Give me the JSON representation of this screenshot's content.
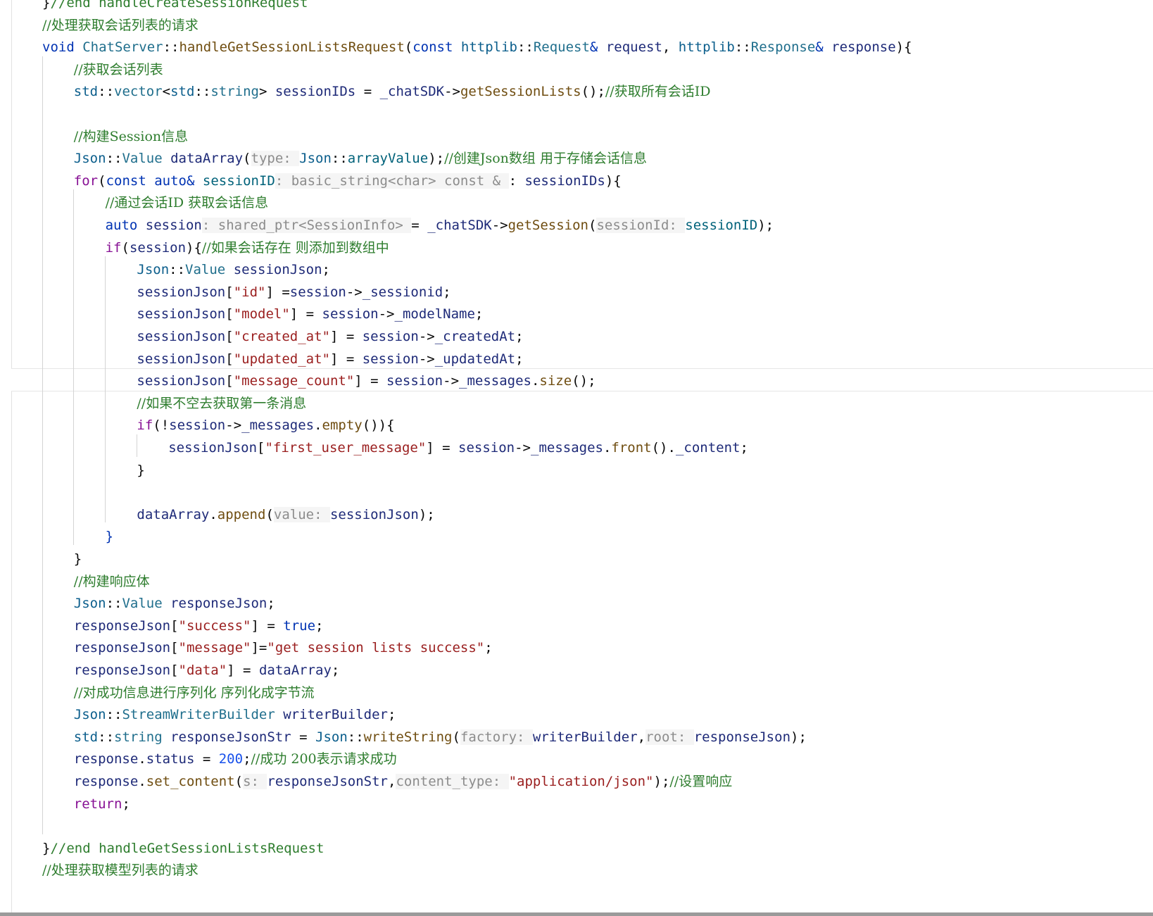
{
  "editor": {
    "lines": [
      {
        "indent": 0,
        "tokens": [
          [
            "p",
            "}"
          ],
          [
            "com-m",
            "//end handleCreateSessionRequest"
          ]
        ]
      },
      {
        "indent": 0,
        "tokens": [
          [
            "com",
            "//处理获取会话列表的请求"
          ]
        ]
      },
      {
        "indent": 0,
        "tokens": [
          [
            "kw",
            "void "
          ],
          [
            "typ",
            "ChatServer"
          ],
          [
            "p",
            "::"
          ],
          [
            "fnm",
            "handleGetSessionListsRequest"
          ],
          [
            "p",
            "("
          ],
          [
            "kw",
            "const "
          ],
          [
            "ns",
            "httplib"
          ],
          [
            "p",
            "::"
          ],
          [
            "typ",
            "Request"
          ],
          [
            "kw",
            "& "
          ],
          [
            "var",
            "request"
          ],
          [
            "p",
            ", "
          ],
          [
            "ns",
            "httplib"
          ],
          [
            "p",
            "::"
          ],
          [
            "typ",
            "Response"
          ],
          [
            "kw",
            "& "
          ],
          [
            "var",
            "response"
          ],
          [
            "p",
            "){"
          ]
        ]
      },
      {
        "indent": 1,
        "tokens": [
          [
            "com",
            "//获取会话列表"
          ]
        ]
      },
      {
        "indent": 1,
        "tokens": [
          [
            "ns",
            "std"
          ],
          [
            "p",
            "::"
          ],
          [
            "typ",
            "vector"
          ],
          [
            "p",
            "<"
          ],
          [
            "ns",
            "std"
          ],
          [
            "p",
            "::"
          ],
          [
            "typ",
            "string"
          ],
          [
            "p",
            "> "
          ],
          [
            "var",
            "sessionIDs"
          ],
          [
            "p",
            " = "
          ],
          [
            "var",
            "_chatSDK"
          ],
          [
            "p",
            "->"
          ],
          [
            "fnm",
            "getSessionLists"
          ],
          [
            "p",
            "();"
          ],
          [
            "com",
            "//获取所有会话ID"
          ]
        ]
      },
      {
        "indent": 1,
        "tokens": []
      },
      {
        "indent": 1,
        "tokens": [
          [
            "com",
            "//构建Session信息"
          ]
        ]
      },
      {
        "indent": 1,
        "tokens": [
          [
            "ns",
            "Json"
          ],
          [
            "p",
            "::"
          ],
          [
            "typ",
            "Value "
          ],
          [
            "var",
            "dataArray"
          ],
          [
            "p",
            "("
          ],
          [
            "hint",
            "type: "
          ],
          [
            "ns",
            "Json"
          ],
          [
            "p",
            "::"
          ],
          [
            "fn",
            "arrayValue"
          ],
          [
            "p",
            ");"
          ],
          [
            "com",
            "//创建Json数组 用于存储会话信息"
          ]
        ]
      },
      {
        "indent": 1,
        "tokens": [
          [
            "kw2",
            "for"
          ],
          [
            "p",
            "("
          ],
          [
            "kw",
            "const "
          ],
          [
            "kw",
            "auto"
          ],
          [
            "kw",
            "& "
          ],
          [
            "fn",
            "sessionID"
          ],
          [
            "hint",
            ": basic_string<char> const & "
          ],
          [
            "p",
            ": "
          ],
          [
            "var",
            "sessionIDs"
          ],
          [
            "p",
            "){"
          ]
        ]
      },
      {
        "indent": 2,
        "tokens": [
          [
            "com",
            "//通过会话ID 获取会话信息"
          ]
        ]
      },
      {
        "indent": 2,
        "tokens": [
          [
            "kw",
            "auto "
          ],
          [
            "var",
            "session"
          ],
          [
            "hint",
            ": shared_ptr<SessionInfo> "
          ],
          [
            "p",
            "= "
          ],
          [
            "var",
            "_chatSDK"
          ],
          [
            "p",
            "->"
          ],
          [
            "fnm",
            "getSession"
          ],
          [
            "p",
            "("
          ],
          [
            "hint",
            "sessionId: "
          ],
          [
            "fn",
            "sessionID"
          ],
          [
            "p",
            ");"
          ]
        ]
      },
      {
        "indent": 2,
        "tokens": [
          [
            "kw2",
            "if"
          ],
          [
            "p",
            "("
          ],
          [
            "var",
            "session"
          ],
          [
            "p",
            "){"
          ],
          [
            "com",
            "//如果会话存在 则添加到数组中"
          ]
        ]
      },
      {
        "indent": 3,
        "tokens": [
          [
            "ns",
            "Json"
          ],
          [
            "p",
            "::"
          ],
          [
            "typ",
            "Value "
          ],
          [
            "var",
            "sessionJson"
          ],
          [
            "p",
            ";"
          ]
        ]
      },
      {
        "indent": 3,
        "tokens": [
          [
            "var",
            "sessionJson"
          ],
          [
            "p",
            "["
          ],
          [
            "str",
            "\"id\""
          ],
          [
            "p",
            "] ="
          ],
          [
            "var",
            "session"
          ],
          [
            "p",
            "->"
          ],
          [
            "var",
            "_sessionid"
          ],
          [
            "p",
            ";"
          ]
        ]
      },
      {
        "indent": 3,
        "tokens": [
          [
            "var",
            "sessionJson"
          ],
          [
            "p",
            "["
          ],
          [
            "str",
            "\"model\""
          ],
          [
            "p",
            "] = "
          ],
          [
            "var",
            "session"
          ],
          [
            "p",
            "->"
          ],
          [
            "var",
            "_modelName"
          ],
          [
            "p",
            ";"
          ]
        ]
      },
      {
        "indent": 3,
        "tokens": [
          [
            "var",
            "sessionJson"
          ],
          [
            "p",
            "["
          ],
          [
            "str",
            "\"created_at\""
          ],
          [
            "p",
            "] = "
          ],
          [
            "var",
            "session"
          ],
          [
            "p",
            "->"
          ],
          [
            "var",
            "_createdAt"
          ],
          [
            "p",
            ";"
          ]
        ]
      },
      {
        "indent": 3,
        "tokens": [
          [
            "var",
            "sessionJson"
          ],
          [
            "p",
            "["
          ],
          [
            "str",
            "\"updated_at\""
          ],
          [
            "p",
            "] = "
          ],
          [
            "var",
            "session"
          ],
          [
            "p",
            "->"
          ],
          [
            "var",
            "_updatedAt"
          ],
          [
            "p",
            ";"
          ]
        ]
      },
      {
        "indent": 3,
        "tokens": [
          [
            "var",
            "sessionJson"
          ],
          [
            "p",
            "["
          ],
          [
            "str",
            "\"message_count\""
          ],
          [
            "p",
            "] = "
          ],
          [
            "var",
            "session"
          ],
          [
            "p",
            "->"
          ],
          [
            "var",
            "_messages"
          ],
          [
            "p",
            "."
          ],
          [
            "fnm",
            "size"
          ],
          [
            "p",
            "();"
          ]
        ]
      },
      {
        "indent": 3,
        "tokens": [
          [
            "com",
            "//如果不空去获取第一条消息"
          ]
        ]
      },
      {
        "indent": 3,
        "tokens": [
          [
            "kw2",
            "if"
          ],
          [
            "p",
            "(!"
          ],
          [
            "var",
            "session"
          ],
          [
            "p",
            "->"
          ],
          [
            "var",
            "_messages"
          ],
          [
            "p",
            "."
          ],
          [
            "fnm",
            "empty"
          ],
          [
            "p",
            "()){"
          ]
        ]
      },
      {
        "indent": 4,
        "tokens": [
          [
            "var",
            "sessionJson"
          ],
          [
            "p",
            "["
          ],
          [
            "str",
            "\"first_user_message\""
          ],
          [
            "p",
            "] = "
          ],
          [
            "var",
            "session"
          ],
          [
            "p",
            "->"
          ],
          [
            "var",
            "_messages"
          ],
          [
            "p",
            "."
          ],
          [
            "fnm",
            "front"
          ],
          [
            "p",
            "()."
          ],
          [
            "var",
            "_content"
          ],
          [
            "p",
            ";"
          ]
        ]
      },
      {
        "indent": 3,
        "tokens": [
          [
            "p",
            "}"
          ]
        ]
      },
      {
        "indent": 3,
        "tokens": []
      },
      {
        "indent": 3,
        "tokens": [
          [
            "var",
            "dataArray"
          ],
          [
            "p",
            "."
          ],
          [
            "fnm",
            "append"
          ],
          [
            "p",
            "("
          ],
          [
            "hint",
            "value: "
          ],
          [
            "var",
            "sessionJson"
          ],
          [
            "p",
            ");"
          ]
        ]
      },
      {
        "indent": 2,
        "tokens": [
          [
            "kw",
            "}"
          ]
        ]
      },
      {
        "indent": 1,
        "tokens": [
          [
            "p",
            "}"
          ]
        ]
      },
      {
        "indent": 1,
        "tokens": [
          [
            "com",
            "//构建响应体"
          ]
        ]
      },
      {
        "indent": 1,
        "tokens": [
          [
            "ns",
            "Json"
          ],
          [
            "p",
            "::"
          ],
          [
            "typ",
            "Value "
          ],
          [
            "var",
            "responseJson"
          ],
          [
            "p",
            ";"
          ]
        ]
      },
      {
        "indent": 1,
        "tokens": [
          [
            "var",
            "responseJson"
          ],
          [
            "p",
            "["
          ],
          [
            "str",
            "\"success\""
          ],
          [
            "p",
            "] = "
          ],
          [
            "kw",
            "true"
          ],
          [
            "p",
            ";"
          ]
        ]
      },
      {
        "indent": 1,
        "tokens": [
          [
            "var",
            "responseJson"
          ],
          [
            "p",
            "["
          ],
          [
            "str",
            "\"message\""
          ],
          [
            "p",
            "]="
          ],
          [
            "str",
            "\"get session lists success\""
          ],
          [
            "p",
            ";"
          ]
        ]
      },
      {
        "indent": 1,
        "tokens": [
          [
            "var",
            "responseJson"
          ],
          [
            "p",
            "["
          ],
          [
            "str",
            "\"data\""
          ],
          [
            "p",
            "] = "
          ],
          [
            "var",
            "dataArray"
          ],
          [
            "p",
            ";"
          ]
        ]
      },
      {
        "indent": 1,
        "tokens": [
          [
            "com",
            "//对成功信息进行序列化 序列化成字节流"
          ]
        ]
      },
      {
        "indent": 1,
        "tokens": [
          [
            "ns",
            "Json"
          ],
          [
            "p",
            "::"
          ],
          [
            "typ",
            "StreamWriterBuilder "
          ],
          [
            "var",
            "writerBuilder"
          ],
          [
            "p",
            ";"
          ]
        ]
      },
      {
        "indent": 1,
        "tokens": [
          [
            "ns",
            "std"
          ],
          [
            "p",
            "::"
          ],
          [
            "typ",
            "string "
          ],
          [
            "var",
            "responseJsonStr"
          ],
          [
            "p",
            " = "
          ],
          [
            "ns",
            "Json"
          ],
          [
            "p",
            "::"
          ],
          [
            "fnm",
            "writeString"
          ],
          [
            "p",
            "("
          ],
          [
            "hint",
            "factory: "
          ],
          [
            "var",
            "writerBuilder"
          ],
          [
            "p",
            ","
          ],
          [
            "hint",
            "root: "
          ],
          [
            "var",
            "responseJson"
          ],
          [
            "p",
            ");"
          ]
        ]
      },
      {
        "indent": 1,
        "tokens": [
          [
            "var",
            "response"
          ],
          [
            "p",
            "."
          ],
          [
            "var",
            "status"
          ],
          [
            "p",
            " = "
          ],
          [
            "num",
            "200"
          ],
          [
            "p",
            ";"
          ],
          [
            "com",
            "//成功 200表示请求成功"
          ]
        ]
      },
      {
        "indent": 1,
        "tokens": [
          [
            "var",
            "response"
          ],
          [
            "p",
            "."
          ],
          [
            "fnm",
            "set_content"
          ],
          [
            "p",
            "("
          ],
          [
            "hint",
            "s: "
          ],
          [
            "var",
            "responseJsonStr"
          ],
          [
            "p",
            ","
          ],
          [
            "hint",
            "content_type: "
          ],
          [
            "str",
            "\"application/json\""
          ],
          [
            "p",
            ");"
          ],
          [
            "com",
            "//设置响应"
          ]
        ]
      },
      {
        "indent": 1,
        "tokens": [
          [
            "kw2",
            "return"
          ],
          [
            "p",
            ";"
          ]
        ]
      },
      {
        "indent": 1,
        "tokens": []
      },
      {
        "indent": 0,
        "tokens": [
          [
            "p",
            "}"
          ],
          [
            "com-m",
            "//end handleGetSessionListsRequest"
          ]
        ]
      },
      {
        "indent": 0,
        "tokens": [
          [
            "com",
            "//处理获取模型列表的请求"
          ]
        ]
      }
    ]
  },
  "colors": {
    "background": "#ffffff",
    "keyword": "#0033b3",
    "control_keyword": "#871094",
    "string": "#9a1e1e",
    "comment": "#2e7d2e",
    "number": "#1750eb",
    "inlay_hint": "#8c8c8c"
  }
}
